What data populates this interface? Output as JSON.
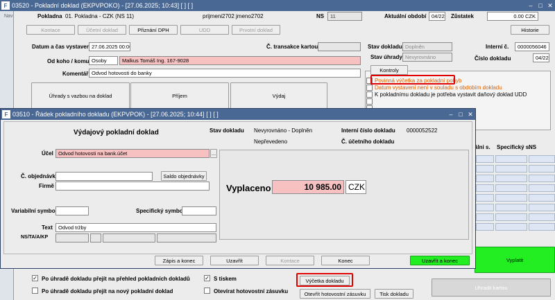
{
  "main": {
    "title": "03520 - Pokladní doklad (EKPVPOKO) - [27.06.2025; 10:43]",
    "title_brackets": "[ ] [ ]",
    "side_label": "Nav",
    "pokladna_label": "Pokladna",
    "pokladna_value": "01. Pokladna - CZK (NS 11)",
    "user_text": "prijmeni2702 jmeno2702",
    "ns_label": "NS",
    "ns_value": "11",
    "obdobi_label": "Aktuální období",
    "obdobi_value": "04/22",
    "zustatek_label": "Zůstatek",
    "zustatek_value": "0.00 CZK",
    "toolbar": [
      "Kontace",
      "Účetní doklad",
      "Přiznání DPH",
      "UDD",
      "Prvotní doklad"
    ],
    "historie_label": "Historie",
    "datum_label": "Datum a čas vystavení",
    "datum_value": "27.06.2025 00:00",
    "transakce_label": "Č. transakce kartou",
    "odkoho_label": "Od koho / komu",
    "odkoho_type": "Osoby",
    "odkoho_value": "Malkus Tomáš Ing. 167-9028",
    "komentar_label": "Komentář",
    "komentar_value": "Odvod hotovosti do banky",
    "action_buttons": [
      "Úhrady s vazbou na doklad",
      "Příjem",
      "Výdaj"
    ],
    "stav_dokladu_label": "Stav dokladu",
    "stav_dokladu_value": "Doplněn",
    "stav_uhrady_label": "Stav úhrady",
    "stav_uhrady_value": "Nevyrovnáno",
    "interni_label": "Interní č.",
    "interni_value": "0000056046",
    "cislo_label": "Číslo dokladu",
    "cislo_value": "04/22",
    "kontroly_label": "Kontroly",
    "kontroly_items": [
      "Povinná výčetka za pokladní pohyb",
      "Datum vystavení není v souladu s obdobím dokladu",
      "K pokladnímu dokladu je potřeba vystavit daňový doklad UDD"
    ],
    "grid_headers": [
      "álni s.",
      "Specifický s.",
      "NS"
    ],
    "vyplatit_label": "Vyplatit",
    "uhradit_label": "Uhradit kartou",
    "bottom_checks": [
      "Po úhradě dokladu přejít na přehled pokladních dokladů",
      "Po úhradě dokladu přejít na nový pokladní doklad",
      "S tiskem",
      "Otevírat hotovostní zásuvku"
    ],
    "vycetka_label": "Výčetka dokladu",
    "otevrit_label": "Otevřít hotovostní zásuvku",
    "tisk_label": "Tisk dokladu",
    "check_mark": "✓"
  },
  "dialog": {
    "title": "03510 - Řádek pokladního dokladu (EKPVPOK) - [27.06.2025; 10:44]",
    "title_brackets": "[ ] [ ]",
    "heading": "Výdajový pokladní doklad",
    "stav_label": "Stav dokladu",
    "stav_value": "Nevyrovnáno - Doplněn",
    "stav_value2": "Nepřevedeno",
    "interni_label": "Interní číslo dokladu",
    "interni_value": "0000052522",
    "ucetni_label": "Č. účetního dokladu",
    "ucel_label": "Účel",
    "ucel_value": "Odvod hotovosti na bank.účet",
    "ucel_more": "...",
    "obj_label": "Č. objednávky",
    "saldo_label": "Saldo objednávky",
    "firma_label": "Firmě",
    "vs_label": "Variabilní symbol",
    "ss_label": "Specifický symbol",
    "text_label": "Text",
    "text_value": "Odvod tržby",
    "ns_label": "NS/TA/A/KP",
    "vyplaceno_label": "Vyplaceno",
    "vyplaceno_value": "10 985.00",
    "currency": "CZK",
    "buttons": [
      "Zápis a konec",
      "Uzavřít",
      "Kontace",
      "Konec",
      "Uzavřít a konec"
    ]
  },
  "colors": {
    "accent_green": "#22ee22",
    "highlight_red": "#e00000",
    "pink": "#f7c1c1",
    "titlebar": "#4a6894"
  }
}
